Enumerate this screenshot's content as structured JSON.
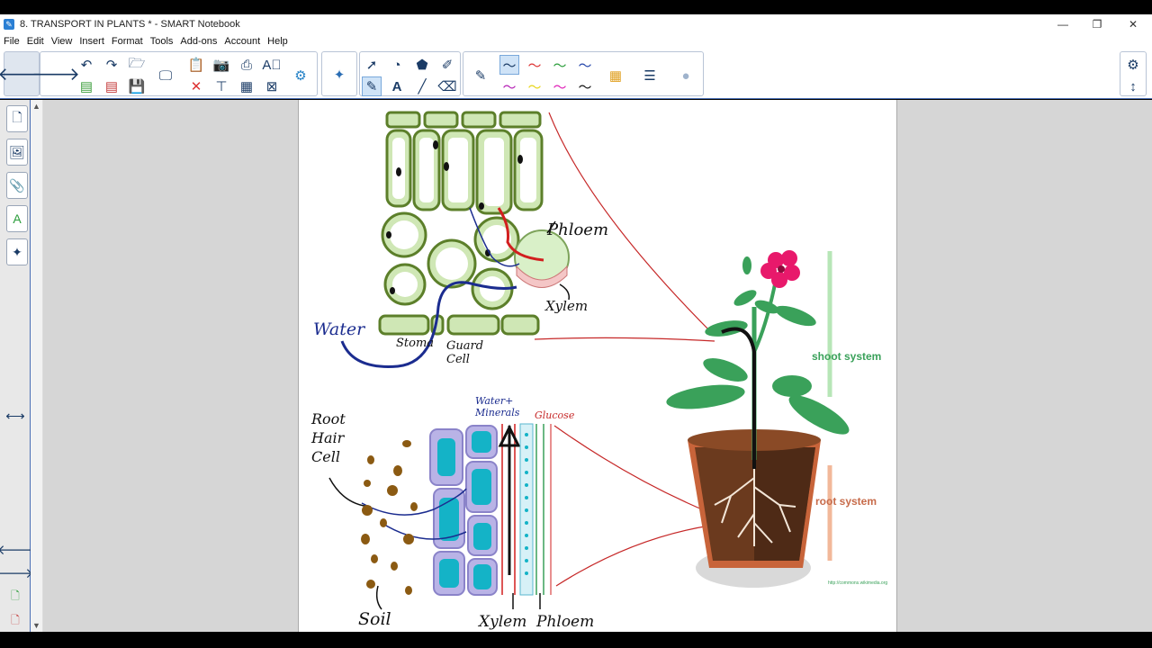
{
  "window": {
    "title": "8. TRANSPORT IN PLANTS * - SMART Notebook",
    "controls": {
      "minimize": "—",
      "maximize": "❐",
      "close": "✕"
    }
  },
  "menu": [
    "File",
    "Edit",
    "View",
    "Insert",
    "Format",
    "Tools",
    "Add-ons",
    "Account",
    "Help"
  ],
  "leftpanel": {
    "collapse_glyph": "⟷"
  },
  "page": {
    "leaf": {
      "phloem": "Phloem",
      "xylem": "Xylem",
      "water": "Water",
      "stoma": "Stoma",
      "guard_cell": "Guard Cell"
    },
    "root": {
      "root_hair_cell": "Root Hair Cell",
      "water_minerals": "Water+ Minerals",
      "glucose": "Glucose",
      "soil": "Soil",
      "xylem": "Xylem",
      "phloem": "Phloem"
    },
    "plant": {
      "shoot_system": "shoot system",
      "root_system": "root system",
      "credit": "http://commons.wikimedia.org"
    }
  },
  "colors": {
    "accent": "#2a5fa8",
    "shoot": "#3aa15a",
    "root_label": "#c76b4a",
    "water_line": "#1b2c8f",
    "sap_line": "#d21f1f",
    "cell_green": "#5c7f2a",
    "cell_fill": "#cfe7b5",
    "root_cell_fill": "#b9b3e6",
    "root_vacuole": "#14b3c7"
  }
}
